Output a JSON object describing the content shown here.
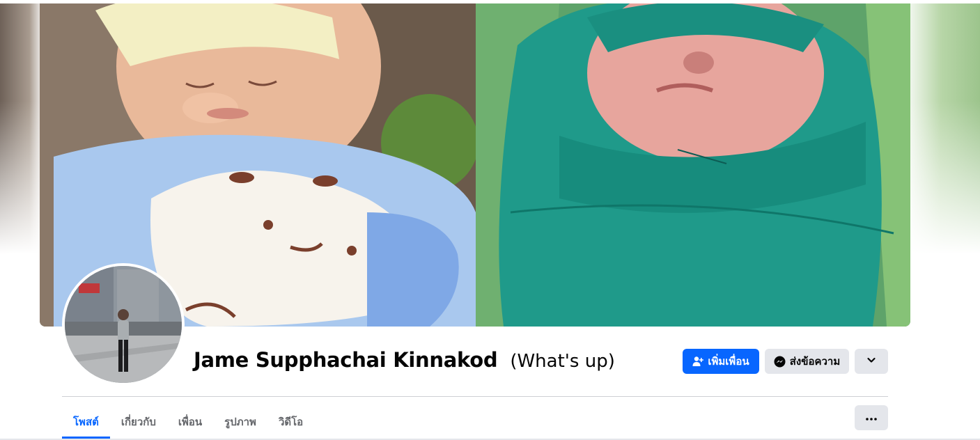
{
  "profile": {
    "name": "Jame Supphachai Kinnakod",
    "alternate_name": "(What's up)"
  },
  "actions": {
    "add_friend_label": "เพิ่มเพื่อน",
    "message_label": "ส่งข้อความ"
  },
  "tabs": [
    {
      "label": "โพสต์",
      "active": true
    },
    {
      "label": "เกี่ยวกับ",
      "active": false
    },
    {
      "label": "เพื่อน",
      "active": false
    },
    {
      "label": "รูปภาพ",
      "active": false
    },
    {
      "label": "วิดีโอ",
      "active": false
    }
  ],
  "colors": {
    "accent": "#0866ff",
    "secondary_button": "#e4e6eb",
    "muted_text": "#65676b"
  },
  "icons": {
    "add_friend": "person-add-icon",
    "message": "messenger-icon",
    "more": "chevron-down-icon",
    "tab_menu": "more-dots-icon"
  }
}
